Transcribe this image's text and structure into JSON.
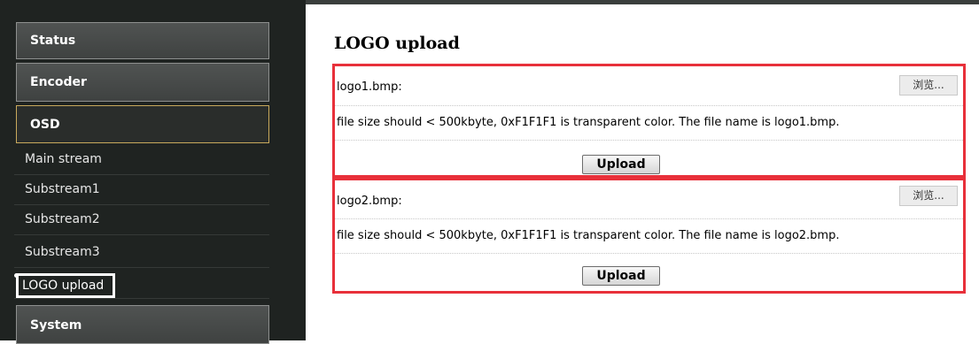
{
  "sidebar": {
    "menu": [
      {
        "label": "Status"
      },
      {
        "label": "Encoder"
      },
      {
        "label": "OSD"
      },
      {
        "label": "System"
      }
    ],
    "osd_items": [
      {
        "label": "Main stream"
      },
      {
        "label": "Substream1"
      },
      {
        "label": "Substream2"
      },
      {
        "label": "Substream3"
      },
      {
        "label": "LOGO upload"
      }
    ]
  },
  "main": {
    "title": "LOGO upload",
    "logos": [
      {
        "file_label": "logo1.bmp:",
        "browse_label": "浏览...",
        "note": "file size should < 500kbyte, 0xF1F1F1 is transparent color. The file name is logo1.bmp.",
        "upload_label": "Upload"
      },
      {
        "file_label": "logo2.bmp:",
        "browse_label": "浏览...",
        "note": "file size should < 500kbyte, 0xF1F1F1 is transparent color. The file name is logo2.bmp.",
        "upload_label": "Upload"
      }
    ]
  },
  "colors": {
    "sidebar_bg": "#1f2321",
    "active_border": "#c9a95c",
    "highlight_box": "#e8303a"
  }
}
